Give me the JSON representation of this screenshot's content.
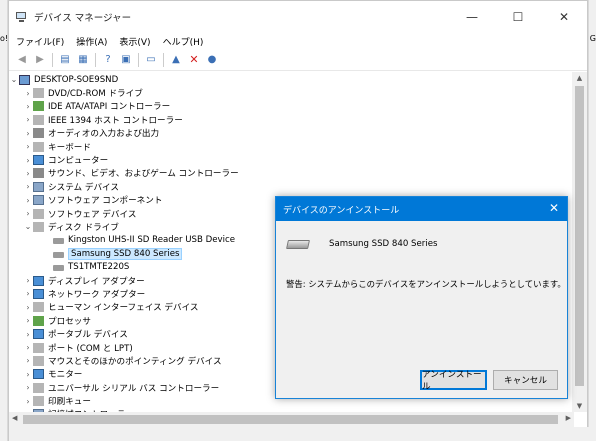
{
  "window": {
    "title": "デバイス マネージャー",
    "min": "—",
    "max": "☐",
    "close": "✕"
  },
  "menu": [
    "ファイル(F)",
    "操作(A)",
    "表示(V)",
    "ヘルプ(H)"
  ],
  "bg_left_text": "o!",
  "bg_right_text": "G",
  "tree": {
    "root": "DESKTOP-SOE9SND",
    "items": [
      {
        "label": "DVD/CD-ROM ドライブ",
        "icon": "disc-icon",
        "level": 1,
        "exp": "›"
      },
      {
        "label": "IDE ATA/ATAPI コントローラー",
        "icon": "ide-icon",
        "level": 1,
        "exp": "›"
      },
      {
        "label": "IEEE 1394 ホスト コントローラー",
        "icon": "ieee-icon",
        "level": 1,
        "exp": "›"
      },
      {
        "label": "オーディオの入力および出力",
        "icon": "speaker-icon",
        "level": 1,
        "exp": "›"
      },
      {
        "label": "キーボード",
        "icon": "keyboard-icon",
        "level": 1,
        "exp": "›"
      },
      {
        "label": "コンピューター",
        "icon": "computer-icon",
        "level": 1,
        "exp": "›"
      },
      {
        "label": "サウンド、ビデオ、およびゲーム コントローラー",
        "icon": "sound-icon",
        "level": 1,
        "exp": "›"
      },
      {
        "label": "システム デバイス",
        "icon": "system-icon",
        "level": 1,
        "exp": "›"
      },
      {
        "label": "ソフトウェア コンポーネント",
        "icon": "component-icon",
        "level": 1,
        "exp": "›"
      },
      {
        "label": "ソフトウェア デバイス",
        "icon": "software-icon",
        "level": 1,
        "exp": "›"
      },
      {
        "label": "ディスク ドライブ",
        "icon": "disk-drive-icon",
        "level": 1,
        "exp": "⌄"
      },
      {
        "label": "Kingston UHS-II SD Reader USB Device",
        "icon": "disk-icon",
        "level": 2,
        "exp": ""
      },
      {
        "label": "Samsung SSD 840 Series",
        "icon": "disk-icon",
        "level": 2,
        "exp": "",
        "selected": true
      },
      {
        "label": "TS1TMTE220S",
        "icon": "disk-icon",
        "level": 2,
        "exp": ""
      },
      {
        "label": "ディスプレイ アダプター",
        "icon": "display-icon",
        "level": 1,
        "exp": "›"
      },
      {
        "label": "ネットワーク アダプター",
        "icon": "network-icon",
        "level": 1,
        "exp": "›"
      },
      {
        "label": "ヒューマン インターフェイス デバイス",
        "icon": "hid-icon",
        "level": 1,
        "exp": "›"
      },
      {
        "label": "プロセッサ",
        "icon": "processor-icon",
        "level": 1,
        "exp": "›"
      },
      {
        "label": "ポータブル デバイス",
        "icon": "portable-icon",
        "level": 1,
        "exp": "›"
      },
      {
        "label": "ポート (COM と LPT)",
        "icon": "port-icon",
        "level": 1,
        "exp": "›"
      },
      {
        "label": "マウスとそのほかのポインティング デバイス",
        "icon": "mouse-icon",
        "level": 1,
        "exp": "›"
      },
      {
        "label": "モニター",
        "icon": "monitor-icon",
        "level": 1,
        "exp": "›"
      },
      {
        "label": "ユニバーサル シリアル バス コントローラー",
        "icon": "usb-icon",
        "level": 1,
        "exp": "›"
      },
      {
        "label": "印刷キュー",
        "icon": "printer-icon",
        "level": 1,
        "exp": "›"
      },
      {
        "label": "記憶域コントローラー",
        "icon": "storage-icon",
        "level": 1,
        "exp": "›"
      }
    ]
  },
  "dialog": {
    "title": "デバイスのアンインストール",
    "device_name": "Samsung SSD 840 Series",
    "warning": "警告: システムからこのデバイスをアンインストールしようとしています。",
    "ok_label": "アンインストール",
    "cancel_label": "キャンセル",
    "close": "✕"
  },
  "colors": {
    "accent": "#0078d7",
    "selection": "#cce8ff"
  }
}
